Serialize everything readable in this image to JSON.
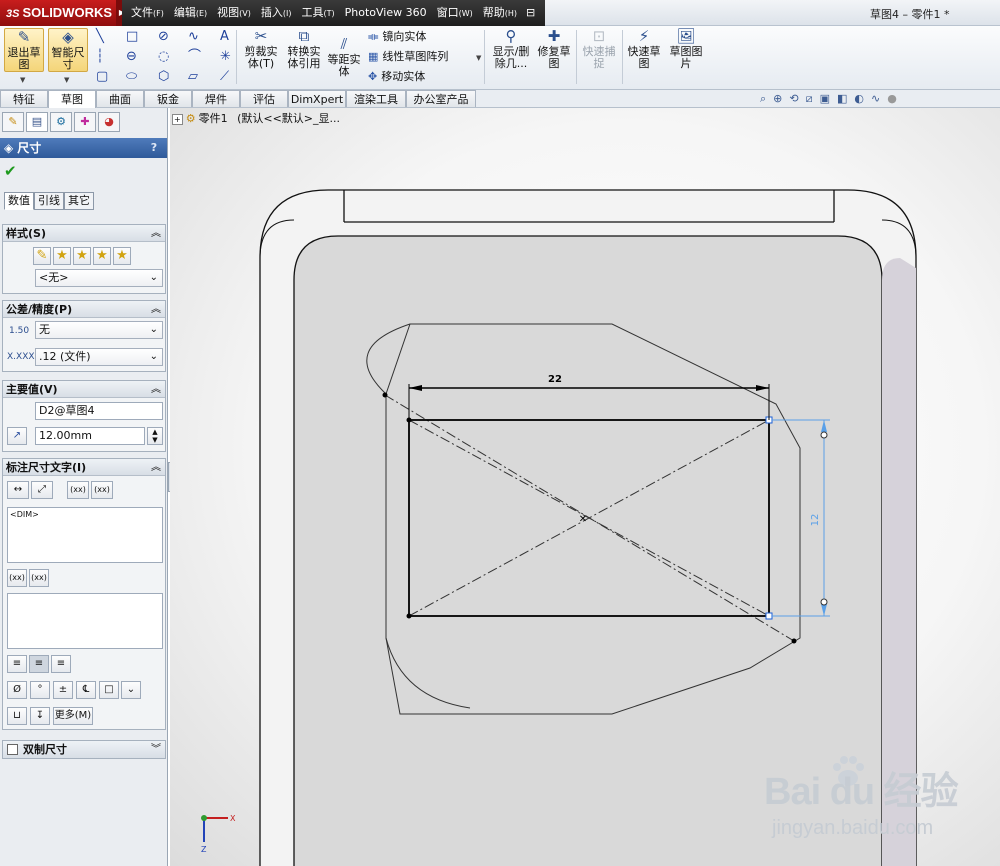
{
  "app": {
    "logo": "SOLIDWORKS",
    "logo_mark": "3S",
    "document_title": "草图4 – 零件1 *"
  },
  "menu": [
    {
      "label": "文件",
      "accel": "(F)"
    },
    {
      "label": "编辑",
      "accel": "(E)"
    },
    {
      "label": "视图",
      "accel": "(V)"
    },
    {
      "label": "插入",
      "accel": "(I)"
    },
    {
      "label": "工具",
      "accel": "(T)"
    },
    {
      "label": "PhotoView 360",
      "accel": ""
    },
    {
      "label": "窗口",
      "accel": "(W)"
    },
    {
      "label": "帮助",
      "accel": "(H)"
    }
  ],
  "ribbon": {
    "exit_sketch": "退出草图",
    "smart_dimension": "智能尺寸",
    "trim": "剪裁实体(T)",
    "convert": "转换实体引用",
    "offset": "等距实体",
    "mirror": "镜向实体",
    "linear_pattern": "线性草图阵列",
    "move": "移动实体",
    "show_delete": "显示/删除几...",
    "repair": "修复草图",
    "quick_snap": "快速捕捉",
    "rapid_sketch": "快速草图",
    "sketch_picture": "草图图片"
  },
  "command_tabs": [
    "特征",
    "草图",
    "曲面",
    "钣金",
    "焊件",
    "评估",
    "DimXpert",
    "渲染工具",
    "办公室产品"
  ],
  "active_tab": "草图",
  "panel": {
    "title": "尺寸",
    "help": "?",
    "sub_tabs": [
      "数值",
      "引线",
      "其它"
    ],
    "style": {
      "heading": "样式(S)",
      "selected": "<无>"
    },
    "tolerance": {
      "heading": "公差/精度(P)",
      "tolerance_type": "无",
      "precision": ".12 (文件)",
      "tol_icon_label": "1.50",
      "prec_icon_label": "X.XXX"
    },
    "primary_value": {
      "heading": "主要值(V)",
      "name": "D2@草图4",
      "value": "12.00mm"
    },
    "dimension_text": {
      "heading": "标注尺寸文字(I)",
      "content": "<DIM>",
      "xx_label": "(xx)",
      "more_button": "更多(M)"
    },
    "dual_dimension": {
      "heading": "双制尺寸"
    }
  },
  "tree": {
    "part_name": "零件1",
    "config": "(默认<<默认>_显..."
  },
  "sketch": {
    "horizontal_dim": "22",
    "vertical_dim": "12"
  },
  "watermark": {
    "brand": "Bai du 经验",
    "url": "jingyan.baidu.com"
  }
}
